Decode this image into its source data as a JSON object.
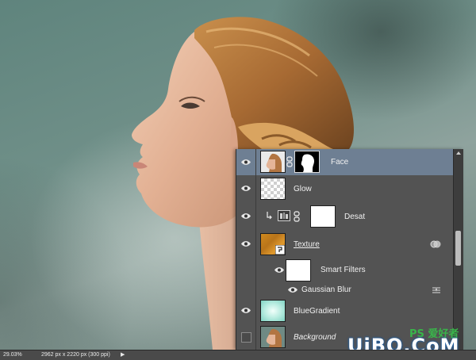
{
  "layers_panel": {
    "layers": [
      {
        "id": "face",
        "name": "Face",
        "selected": true
      },
      {
        "id": "glow",
        "name": "Glow"
      },
      {
        "id": "desat",
        "name": "Desat"
      },
      {
        "id": "texture",
        "name": "Texture"
      },
      {
        "id": "smart_filters",
        "name": "Smart Filters"
      },
      {
        "id": "gaussian_blur",
        "name": "Gaussian Blur"
      },
      {
        "id": "bluegradient",
        "name": "BlueGradient"
      },
      {
        "id": "background",
        "name": "Background"
      }
    ]
  },
  "status_bar": {
    "zoom": "29.03%",
    "doc_info": "2962 px x 2220 px (300 ppi)",
    "arrow": "▶"
  },
  "watermark": {
    "top_text": "PS 爱好者",
    "main_text": "UiBQ.CoM"
  },
  "colors": {
    "panel_bg": "#535353",
    "selected_row": "#6e7f93",
    "watermark_green": "#39b54a"
  }
}
